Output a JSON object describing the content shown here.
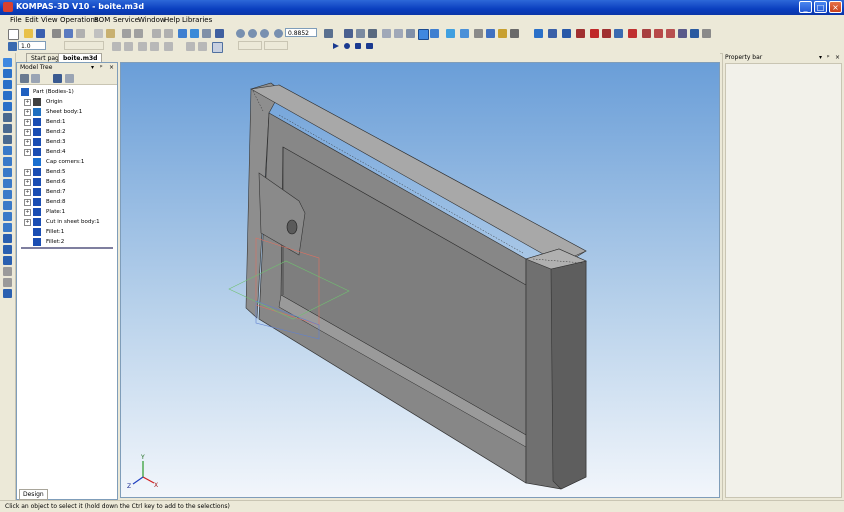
{
  "window": {
    "title": "KOMPAS-3D V10 - boite.m3d",
    "minimize": "_",
    "maximize": "□",
    "close": "×"
  },
  "menu": [
    "File",
    "Edit",
    "View",
    "Operations",
    "BOM",
    "Service",
    "Window",
    "Help",
    "Libraries"
  ],
  "toolbar": {
    "zoom_value": "0.8852",
    "scale_value": "1.0"
  },
  "tabs": [
    "Start page",
    "boite.m3d"
  ],
  "model_tree": {
    "title": "Model Tree",
    "controls": [
      "▾",
      "ᵖ",
      "×"
    ],
    "nodes": [
      {
        "label": "Part (Bodies-1)",
        "expander": "",
        "icon": "part-icon",
        "color": "#2060c0"
      },
      {
        "label": "Origin",
        "expander": "+",
        "icon": "origin-icon",
        "color": "#404040"
      },
      {
        "label": "Sheet body:1",
        "expander": "+",
        "icon": "sheet-body-icon",
        "color": "#1f6fc0"
      },
      {
        "label": "Bend:1",
        "expander": "+",
        "icon": "bend-icon",
        "color": "#1a4db3"
      },
      {
        "label": "Bend:2",
        "expander": "+",
        "icon": "bend-icon",
        "color": "#1a4db3"
      },
      {
        "label": "Bend:3",
        "expander": "+",
        "icon": "bend-icon",
        "color": "#1a4db3"
      },
      {
        "label": "Bend:4",
        "expander": "+",
        "icon": "bend-icon",
        "color": "#1a4db3"
      },
      {
        "label": "Cap corners:1",
        "expander": "",
        "icon": "cap-corners-icon",
        "color": "#1a6fd0"
      },
      {
        "label": "Bend:5",
        "expander": "+",
        "icon": "bend-icon",
        "color": "#1a4db3"
      },
      {
        "label": "Bend:6",
        "expander": "+",
        "icon": "bend-icon",
        "color": "#1a4db3"
      },
      {
        "label": "Bend:7",
        "expander": "+",
        "icon": "bend-icon",
        "color": "#1a4db3"
      },
      {
        "label": "Bend:8",
        "expander": "+",
        "icon": "bend-icon",
        "color": "#1a4db3"
      },
      {
        "label": "Plate:1",
        "expander": "+",
        "icon": "plate-icon",
        "color": "#1a4db3"
      },
      {
        "label": "Cut in sheet body:1",
        "expander": "+",
        "icon": "cut-icon",
        "color": "#1a4db3"
      },
      {
        "label": "Fillet:1",
        "expander": "",
        "icon": "fillet-icon",
        "color": "#1a4db3"
      },
      {
        "label": "Fillet:2",
        "expander": "",
        "icon": "fillet-icon",
        "color": "#1a4db3"
      }
    ],
    "bottom_tab": "Design"
  },
  "property_bar": {
    "title": "Property bar",
    "controls": [
      "▾",
      "ᵖ",
      "×"
    ]
  },
  "axes": {
    "x": "X",
    "y": "Y",
    "z": "Z"
  },
  "status": "Click an object to select it (hold down the Ctrl key to add to the selections)"
}
